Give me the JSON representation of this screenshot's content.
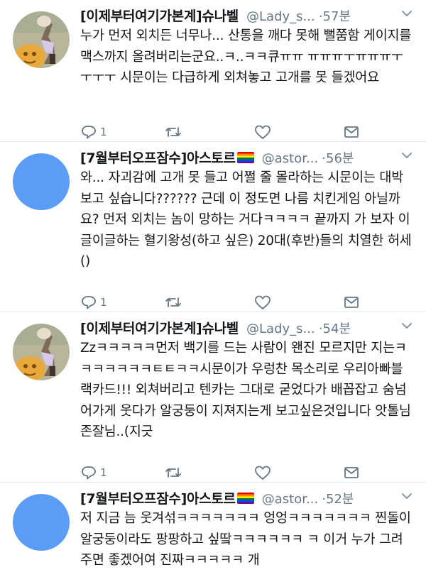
{
  "tweets": [
    {
      "name": "[이제부터여기가본계]슈나벨",
      "handle": "@Lady_s...",
      "time": "57분",
      "body": "누가 먼저 외치든 너무나... 산통을 깨다 못해 뻘쭘함 게이지를 맥스까지 올려버리는군요..ㅋ..ㅋㅋ큐ㅠㅠ ㅠㅠㅠㅜㅠㅠㅠㅜㅜㅜㅜ 시문이는 다급하게 외쳐놓고 고개를 못 들겠어요",
      "reply_count": "1",
      "retweet_count": "",
      "like_count": "",
      "avatar": "illustrated-figure"
    },
    {
      "name": "[7월부터오프잠수]아스토르",
      "handle": "@astor...",
      "time": "56분",
      "body": "와... 자괴감에 고개 못 들고 어쩔 줄 몰라하는 시문이는 대박 보고 싶습니다?????? 근데 이 정도면 나름 치킨게임 아닐까요? 먼저 외치는 놈이 망하는 거다ㅋㅋㅋㅋ 끝까지 가 보자 이글이글하는 혈기왕성(하고 싶은) 20대(후반)들의 치열한 허세()",
      "reply_count": "1",
      "retweet_count": "",
      "like_count": "",
      "avatar": "blue-circle"
    },
    {
      "name": "[이제부터여기가본계]슈나벨",
      "handle": "@Lady_s...",
      "time": "54분",
      "body": "Zzㅋㅋㅋㅋㅋ먼저 백기를 드는 사람이 왠진 모르지만 지는ㅋㅋㅋㅋㅋㅋㅋㅌㅌㅋㅋ시문이가 우렁찬 목소리로 우리아빠블랙카드!!! 외쳐버리고 텐카는 그대로 굳었다가 배꼽잡고 숨넘어가게 웃다가 알궁둥이 지져지는게 보고싶은것입니다 앗톨님 존잘님..(지긋",
      "reply_count": "1",
      "retweet_count": "",
      "like_count": "",
      "avatar": "illustrated-figure"
    },
    {
      "name": "[7월부터오프잠수]아스토르",
      "handle": "@astor...",
      "time": "52분",
      "body": "저 지금 늠 웃겨섞ㅋㅋㅋㅋㅋㅋㅋ 엉엉ㅋㅋㅋㅋㅋㅋㅋ 찐돌이 알궁둥이라도 팡팡하고 싶땈ㅋㅋㅋㅋㅋㅋ ㅋ 이거 누가 그려주면 좋겠어여 진짜ㅋㅋㅋㅋㅋ 개",
      "reply_count": "",
      "retweet_count": "",
      "like_count": "",
      "avatar": "blue-circle"
    }
  ],
  "colors": {
    "text": "#14171a",
    "secondary": "#657786",
    "avatar_blue": "#5b9cf6",
    "divider": "#e1e8ed"
  },
  "icons": [
    "reply-icon",
    "retweet-icon",
    "like-icon",
    "direct-message-icon",
    "chevron-down-icon"
  ]
}
